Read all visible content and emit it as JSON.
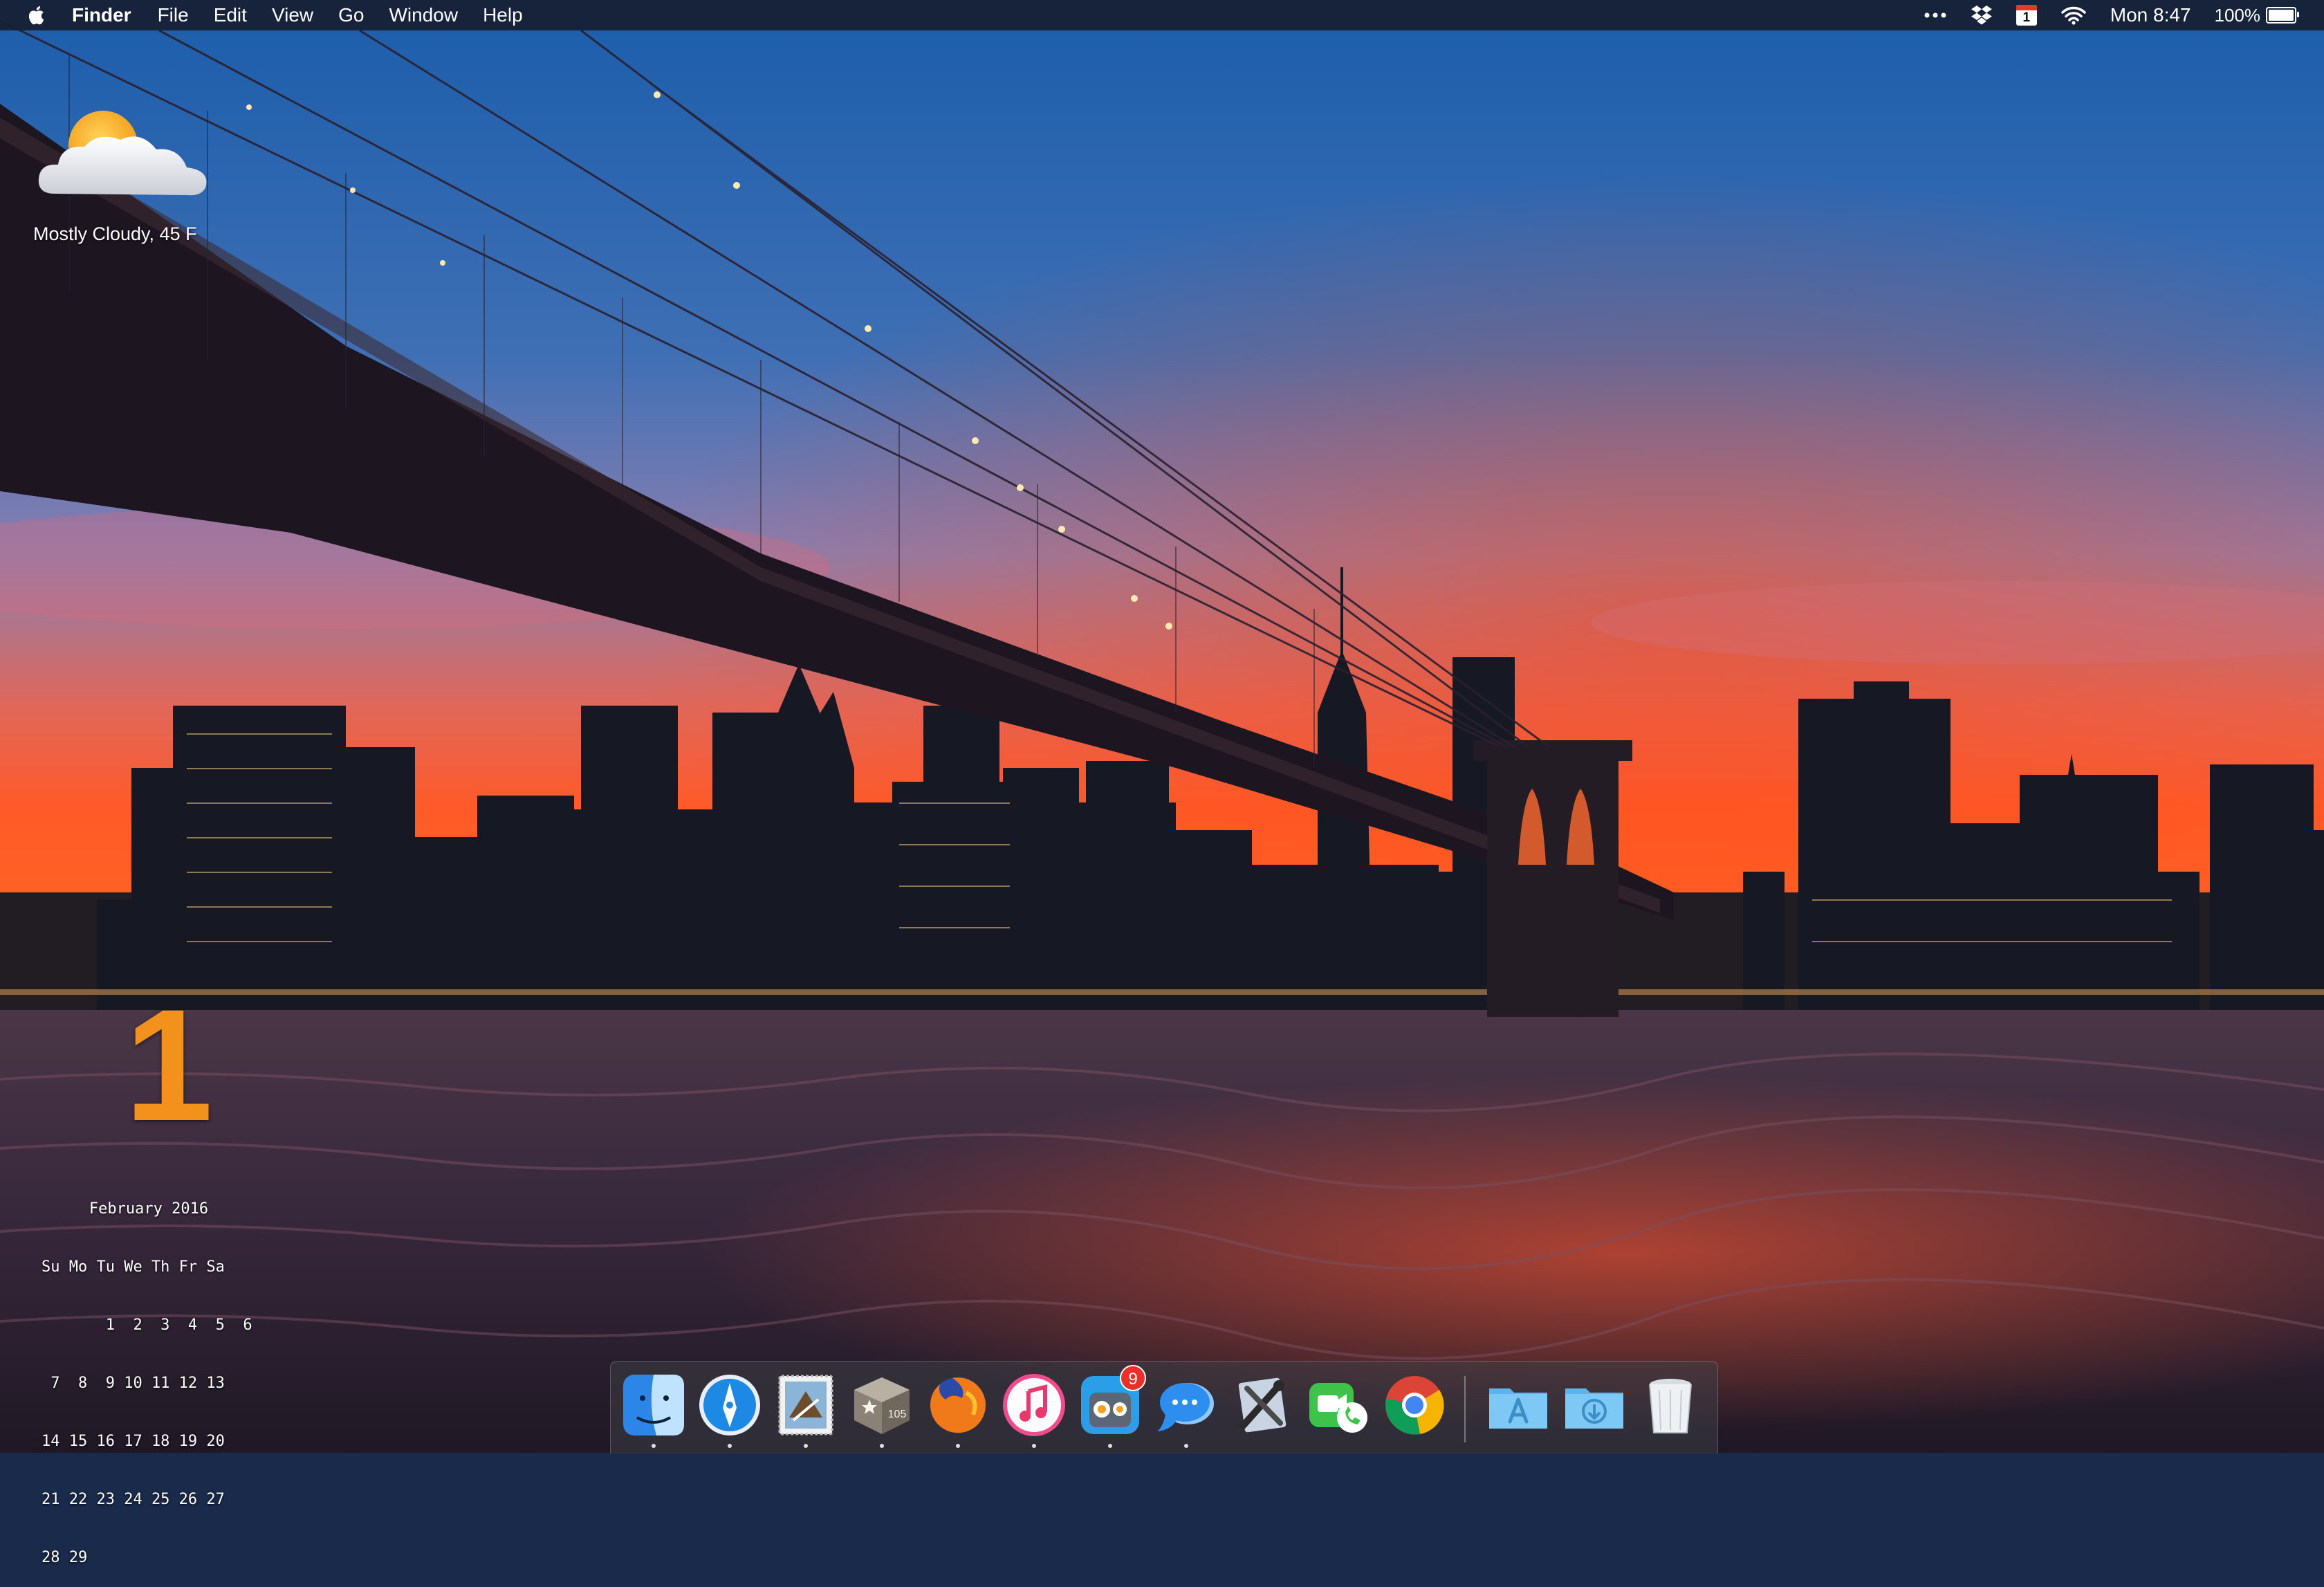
{
  "menubar": {
    "app_name": "Finder",
    "menus": [
      "File",
      "Edit",
      "View",
      "Go",
      "Window",
      "Help"
    ],
    "status": {
      "more_icon": "ellipsis-icon",
      "dropbox_icon": "dropbox-icon",
      "calendar_day": "1",
      "wifi_icon": "wifi-icon",
      "clock": "Mon 8:47",
      "battery_percent": "100%",
      "battery_level": 1.0
    }
  },
  "weather": {
    "icon": "partly-cloudy-icon",
    "text": "Mostly Cloudy, 45 F"
  },
  "calendar": {
    "today": "1",
    "month_title": "February 2016",
    "weekday_header": "Su Mo Tu We Th Fr Sa",
    "weeks": [
      "       1  2  3  4  5  6",
      " 7  8  9 10 11 12 13",
      "14 15 16 17 18 19 20",
      "21 22 23 24 25 26 27",
      "28 29"
    ]
  },
  "dock": {
    "apps": [
      {
        "name": "finder-icon",
        "running": true
      },
      {
        "name": "safari-like-compass-icon",
        "running": true
      },
      {
        "name": "mail-stamp-icon",
        "running": true
      },
      {
        "name": "package-105-icon",
        "label": "105",
        "running": true
      },
      {
        "name": "firefox-icon",
        "running": true
      },
      {
        "name": "itunes-icon",
        "running": true
      },
      {
        "name": "tweetbot-icon",
        "badge": "9",
        "running": true
      },
      {
        "name": "messages-icon",
        "running": true
      },
      {
        "name": "xcode-tools-icon",
        "running": false
      },
      {
        "name": "facetime-icon",
        "running": false
      },
      {
        "name": "chrome-icon",
        "running": false
      },
      {
        "name": "applications-folder-icon",
        "running": false
      },
      {
        "name": "downloads-folder-icon",
        "running": false
      },
      {
        "name": "trash-icon",
        "running": false
      }
    ]
  },
  "colors": {
    "menubar": "#161e30",
    "calendar_accent": "#f3911d",
    "badge": "#e8312a"
  }
}
